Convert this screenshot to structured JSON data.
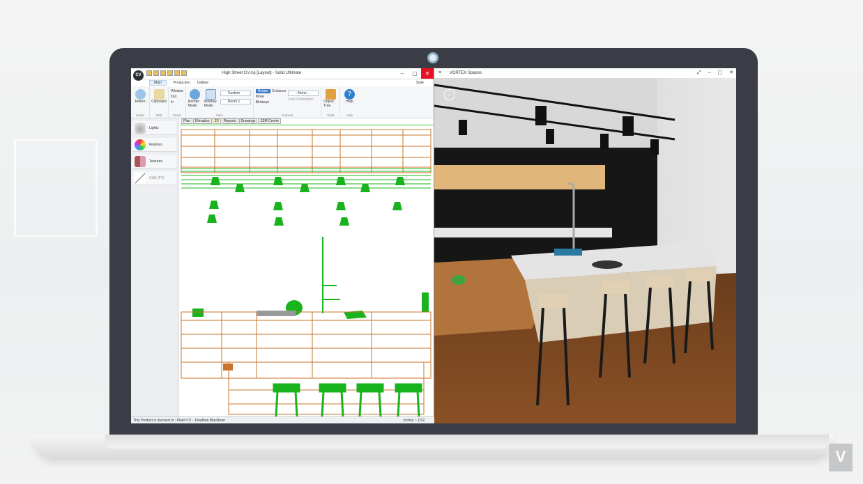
{
  "cad": {
    "logo": "CV",
    "title": "High Street CV.cvj [Layout] - Solid Ultimate",
    "tabs": [
      "Main",
      "Production",
      "Utilities"
    ],
    "tab_right": "Style",
    "ribbon": {
      "return": "Return",
      "clipboard": "Clipboard",
      "zoom_window": "Window",
      "zoom_out": "Out",
      "zoom_in": "In",
      "render_mode": "Render Mode",
      "window_mode": "Window Mode",
      "custom_combo": "Custom",
      "room_combo": "Room 1",
      "rotate_toggle": "Rotate",
      "enhance": "Enhance",
      "move": "Move",
      "birdseye": "Birdseye",
      "camera_combo": "--None--",
      "lock_orientation": "Lock Orientation",
      "object_tree": "Object Tree",
      "help": "Help",
      "groups": [
        "Home",
        "Edit",
        "Zoom",
        "View",
        "Camera",
        "Tools",
        "Help"
      ]
    },
    "panel_items": [
      "Lights",
      "Finishes",
      "Textures",
      "CAD (F7)"
    ],
    "view_tabs": [
      "Plan",
      "Elevation",
      "3D",
      "Reports",
      "Drawings",
      "S2M Centre"
    ],
    "status_left": "This Product is licensed to : Planit CV - Jonathan Blackburn",
    "status_right": "Inches ~ 1/32"
  },
  "vortex": {
    "title": "VORTEX Spaces",
    "back": "←"
  },
  "colors": {
    "wire_orange": "#c8742a",
    "wire_green": "#19b31e",
    "laptop_bezel": "#3a3d45",
    "close_red": "#e81123"
  },
  "brand_mark": "V"
}
